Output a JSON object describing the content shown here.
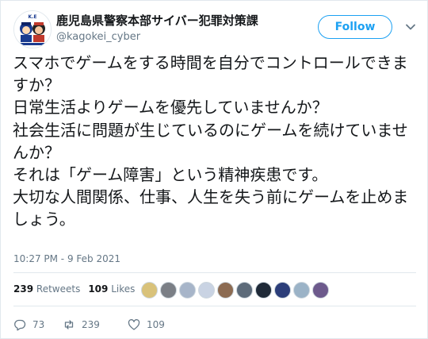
{
  "account": {
    "display_name": "鹿児島県警察本部サイバー犯罪対策課",
    "handle": "@kagokei_cyber",
    "avatar_icon": "police-mascot-avatar-icon"
  },
  "follow_label": "Follow",
  "tweet_text": "スマホでゲームをする時間を自分でコントロールできますか？\n日常生活よりゲームを優先していませんか？\n社会生活に問題が生じているのにゲームを続けていませんか？\nそれは「ゲーム障害」という精神疾患です。\n大切な人間関係、仕事、人生を失う前にゲームを止めましょう。",
  "timestamp": "10:27 PM - 9 Feb 2021",
  "stats": {
    "retweets_count": "239",
    "retweets_label": "Retweets",
    "likes_count": "109",
    "likes_label": "Likes"
  },
  "actions": {
    "reply_count": "73",
    "retweet_count": "239",
    "like_count": "109"
  },
  "colors": {
    "accent": "#1da1f2",
    "text": "#14171a",
    "muted": "#657786",
    "border": "#e1e8ed"
  }
}
